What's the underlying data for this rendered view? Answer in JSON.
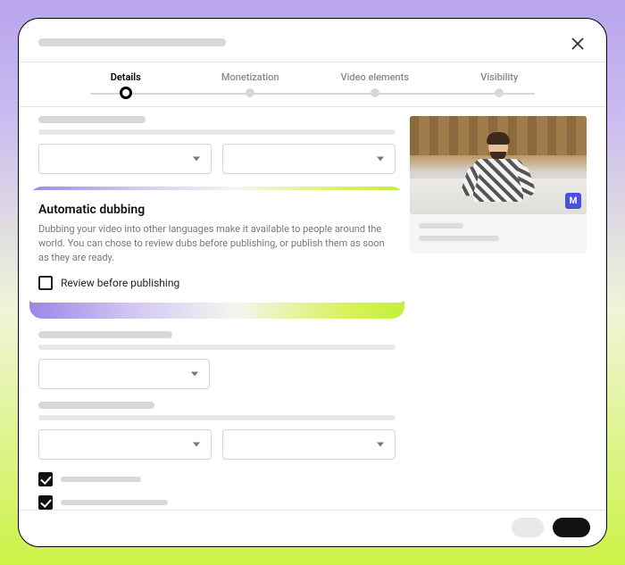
{
  "steps": {
    "details": "Details",
    "monetization": "Monetization",
    "video_elements": "Video elements",
    "visibility": "Visibility"
  },
  "dubbing": {
    "title": "Automatic dubbing",
    "description": "Dubbing your video into other languages make it available to people around the world. You can chose to review dubs before publishing, or publish them as soon as they are ready.",
    "checkbox_label": "Review before publishing",
    "checked": false
  },
  "thumbnail": {
    "badge": "M"
  },
  "bottom_checks": [
    {
      "checked": true
    },
    {
      "checked": true
    }
  ]
}
